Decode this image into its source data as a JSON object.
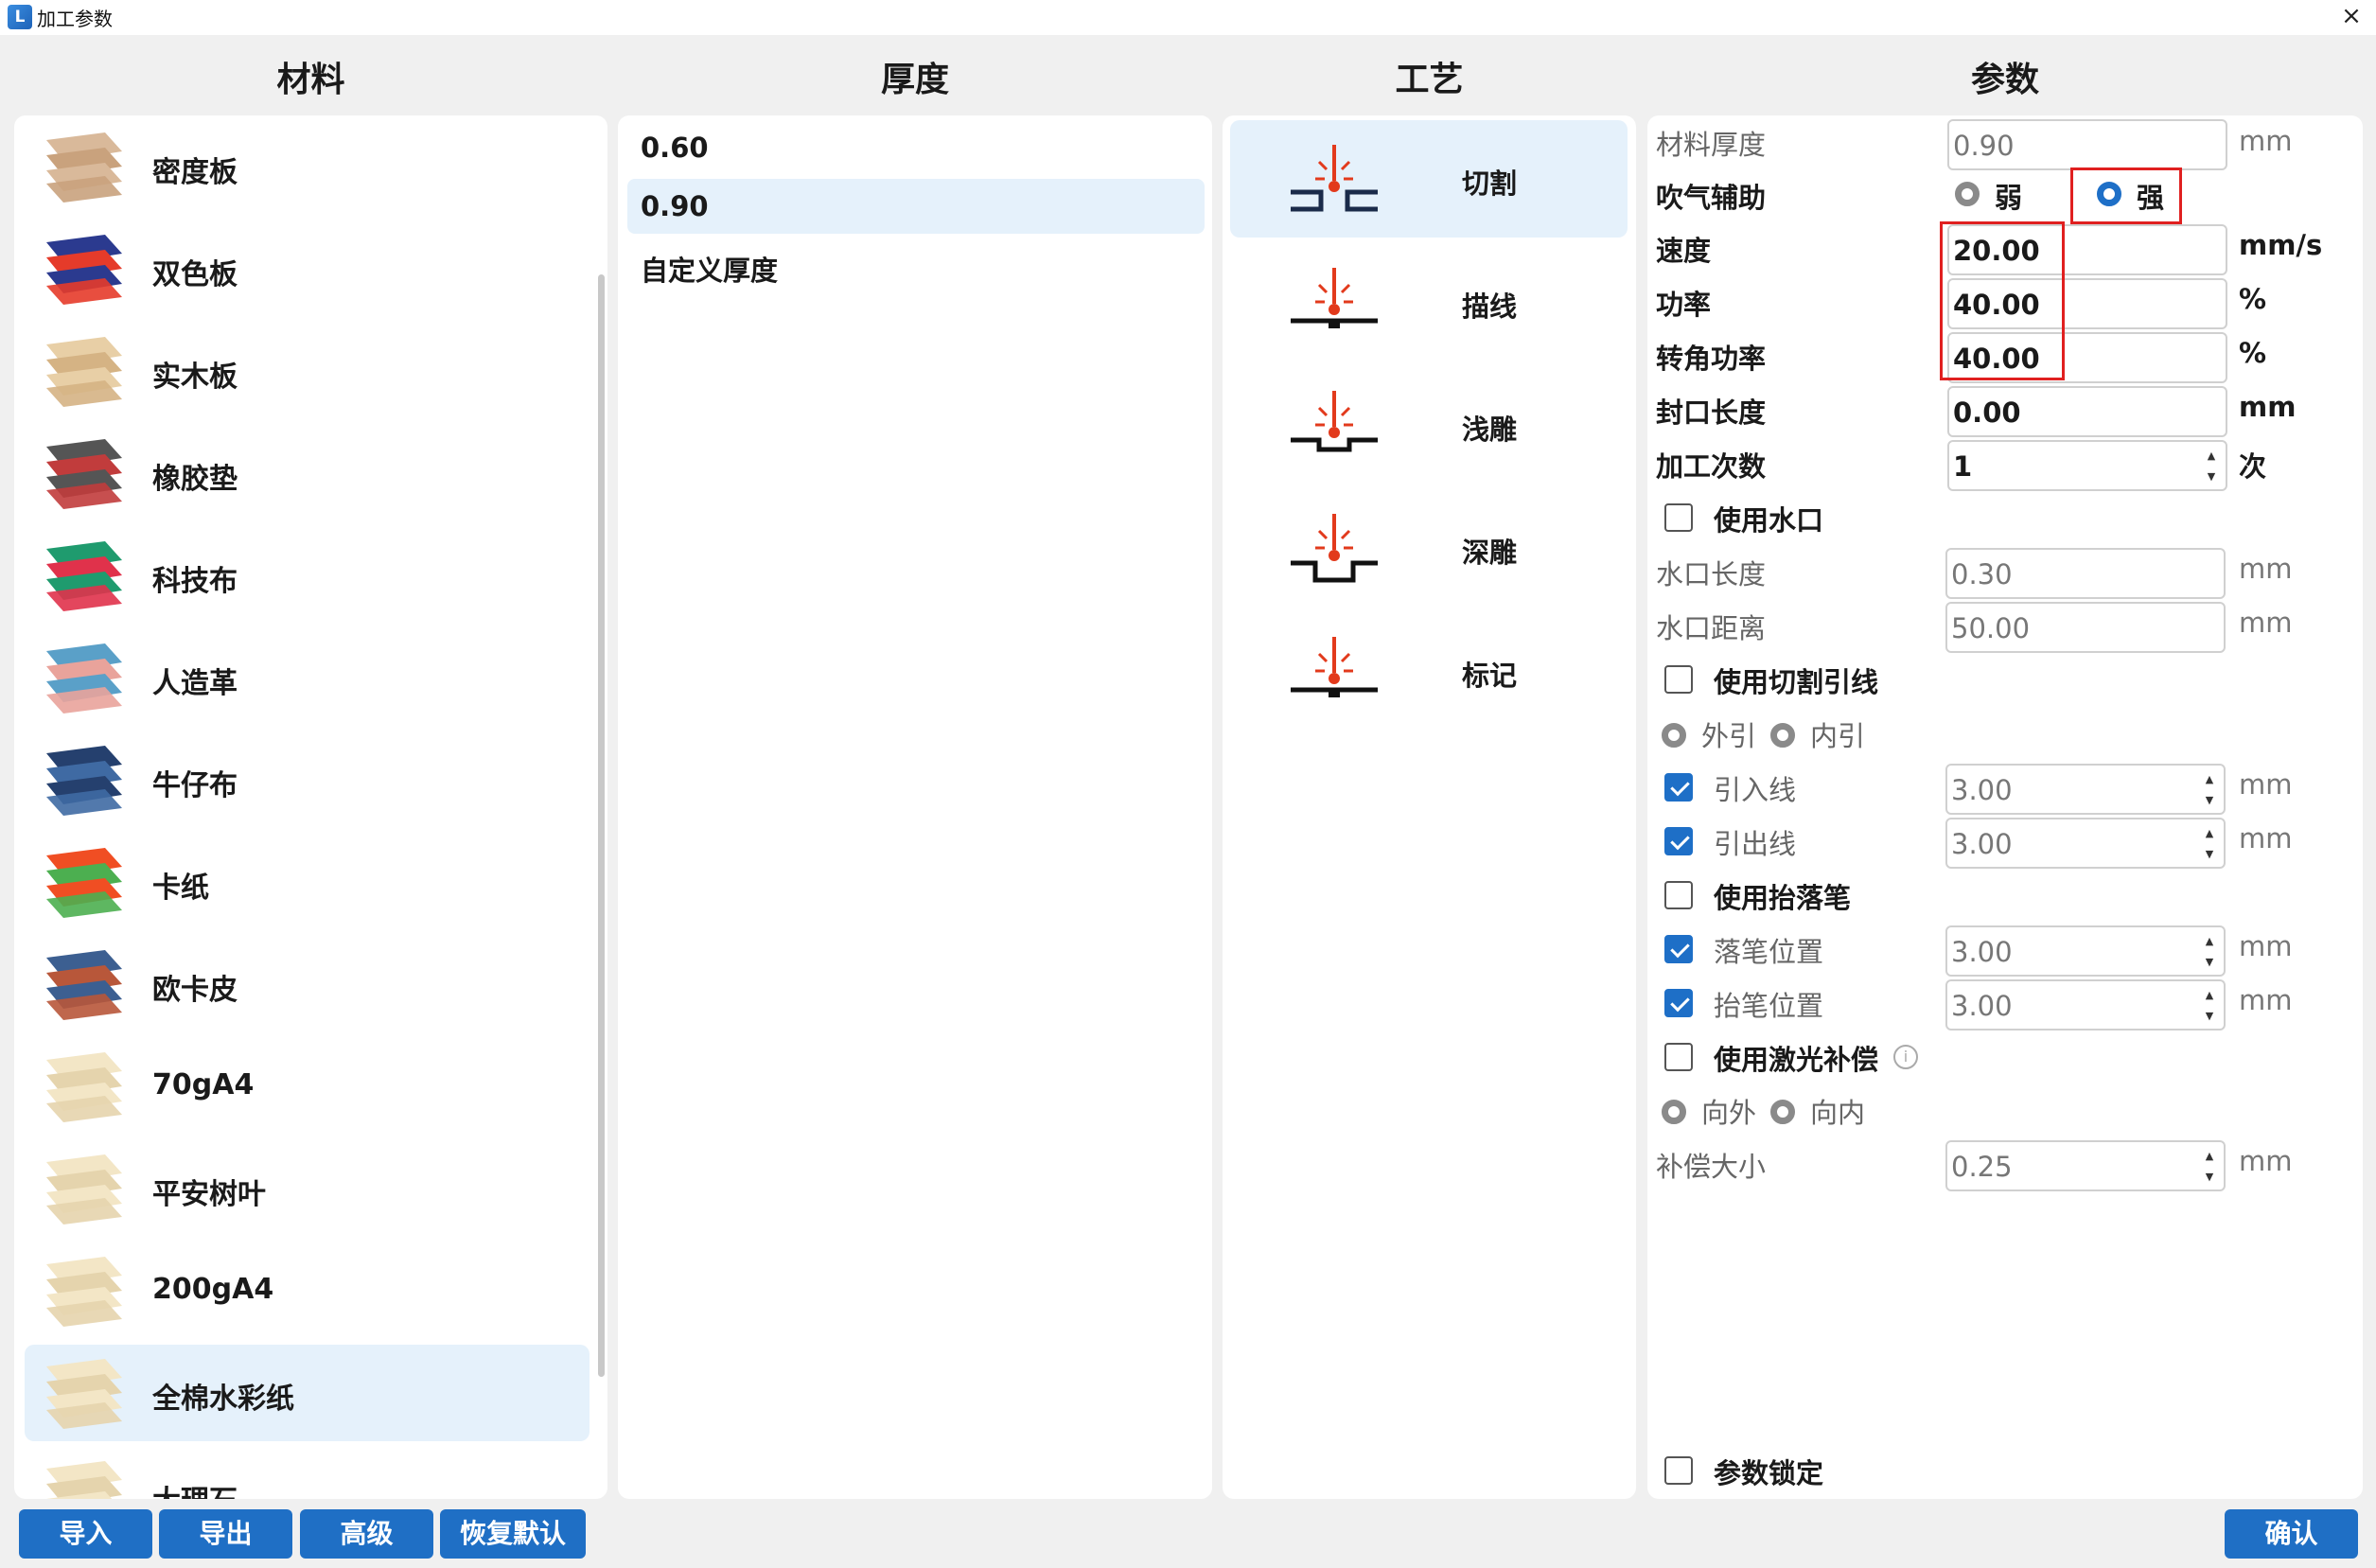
{
  "window": {
    "title": "加工参数",
    "close_icon": "×"
  },
  "headers": {
    "material": "材料",
    "thickness": "厚度",
    "process": "工艺",
    "params": "参数"
  },
  "materials": [
    {
      "label": "密度板",
      "colors": [
        "#d9b99a",
        "#c9a27d"
      ]
    },
    {
      "label": "双色板",
      "colors": [
        "#2b3a8f",
        "#e53b2a"
      ]
    },
    {
      "label": "实木板",
      "colors": [
        "#e8cfa6",
        "#d5b384"
      ]
    },
    {
      "label": "橡胶垫",
      "colors": [
        "#555555",
        "#c13c3c"
      ]
    },
    {
      "label": "科技布",
      "colors": [
        "#1f9b6e",
        "#e0324b"
      ]
    },
    {
      "label": "人造革",
      "colors": [
        "#5aa0c8",
        "#e9a39b"
      ]
    },
    {
      "label": "牛仔布",
      "colors": [
        "#25406e",
        "#3f6aa3"
      ]
    },
    {
      "label": "卡纸",
      "colors": [
        "#f04e23",
        "#4caf50"
      ]
    },
    {
      "label": "欧卡皮",
      "colors": [
        "#3c5f91",
        "#b8573a"
      ]
    },
    {
      "label": "70gA4",
      "colors": [
        "#f3e6c6",
        "#e5d4ad"
      ]
    },
    {
      "label": "平安树叶",
      "colors": [
        "#f3e6c6",
        "#e5d4ad"
      ]
    },
    {
      "label": "200gA4",
      "colors": [
        "#f3e6c6",
        "#e5d4ad"
      ]
    },
    {
      "label": "全棉水彩纸",
      "colors": [
        "#f3e6c6",
        "#e5d4ad"
      ]
    },
    {
      "label": "大理石",
      "colors": [
        "#f3e6c6",
        "#e5d4ad"
      ]
    }
  ],
  "thickness": [
    "0.60",
    "0.90",
    "自定义厚度"
  ],
  "processes": [
    "切割",
    "描线",
    "浅雕",
    "深雕",
    "标记"
  ],
  "params": {
    "material_thickness": {
      "label": "材料厚度",
      "value": "0.90",
      "unit": "mm"
    },
    "air_assist": {
      "label": "吹气辅助",
      "weak": "弱",
      "strong": "强",
      "selected": "强"
    },
    "speed": {
      "label": "速度",
      "value": "20.00",
      "unit": "mm/s"
    },
    "power": {
      "label": "功率",
      "value": "40.00",
      "unit": "%"
    },
    "corner_power": {
      "label": "转角功率",
      "value": "40.00",
      "unit": "%"
    },
    "seal_length": {
      "label": "封口长度",
      "value": "0.00",
      "unit": "mm"
    },
    "passes": {
      "label": "加工次数",
      "value": "1",
      "unit": "次"
    },
    "use_tab": {
      "label": "使用水口",
      "checked": false
    },
    "tab_length": {
      "label": "水口长度",
      "value": "0.30",
      "unit": "mm"
    },
    "tab_distance": {
      "label": "水口距离",
      "value": "50.00",
      "unit": "mm"
    },
    "use_lead": {
      "label": "使用切割引线",
      "checked": false
    },
    "lead_dir": {
      "outer": "外引",
      "inner": "内引"
    },
    "lead_in": {
      "label": "引入线",
      "checked": true,
      "value": "3.00",
      "unit": "mm"
    },
    "lead_out": {
      "label": "引出线",
      "checked": true,
      "value": "3.00",
      "unit": "mm"
    },
    "use_pen": {
      "label": "使用抬落笔",
      "checked": false
    },
    "pen_down": {
      "label": "落笔位置",
      "checked": true,
      "value": "3.00",
      "unit": "mm"
    },
    "pen_up": {
      "label": "抬笔位置",
      "checked": true,
      "value": "3.00",
      "unit": "mm"
    },
    "use_comp": {
      "label": "使用激光补偿",
      "checked": false,
      "info_icon": "i"
    },
    "comp_dir": {
      "outward": "向外",
      "inward": "向内"
    },
    "comp_size": {
      "label": "补偿大小",
      "value": "0.25",
      "unit": "mm"
    },
    "lock": {
      "label": "参数锁定",
      "checked": false
    }
  },
  "buttons": {
    "import": "导入",
    "export": "导出",
    "advanced": "高级",
    "restore": "恢复默认",
    "confirm": "确认"
  },
  "colors": {
    "accent": "#1f6fc5",
    "selection": "#e5f1fb",
    "laser": "#e23a1c",
    "highlight_box": "#e02020"
  }
}
